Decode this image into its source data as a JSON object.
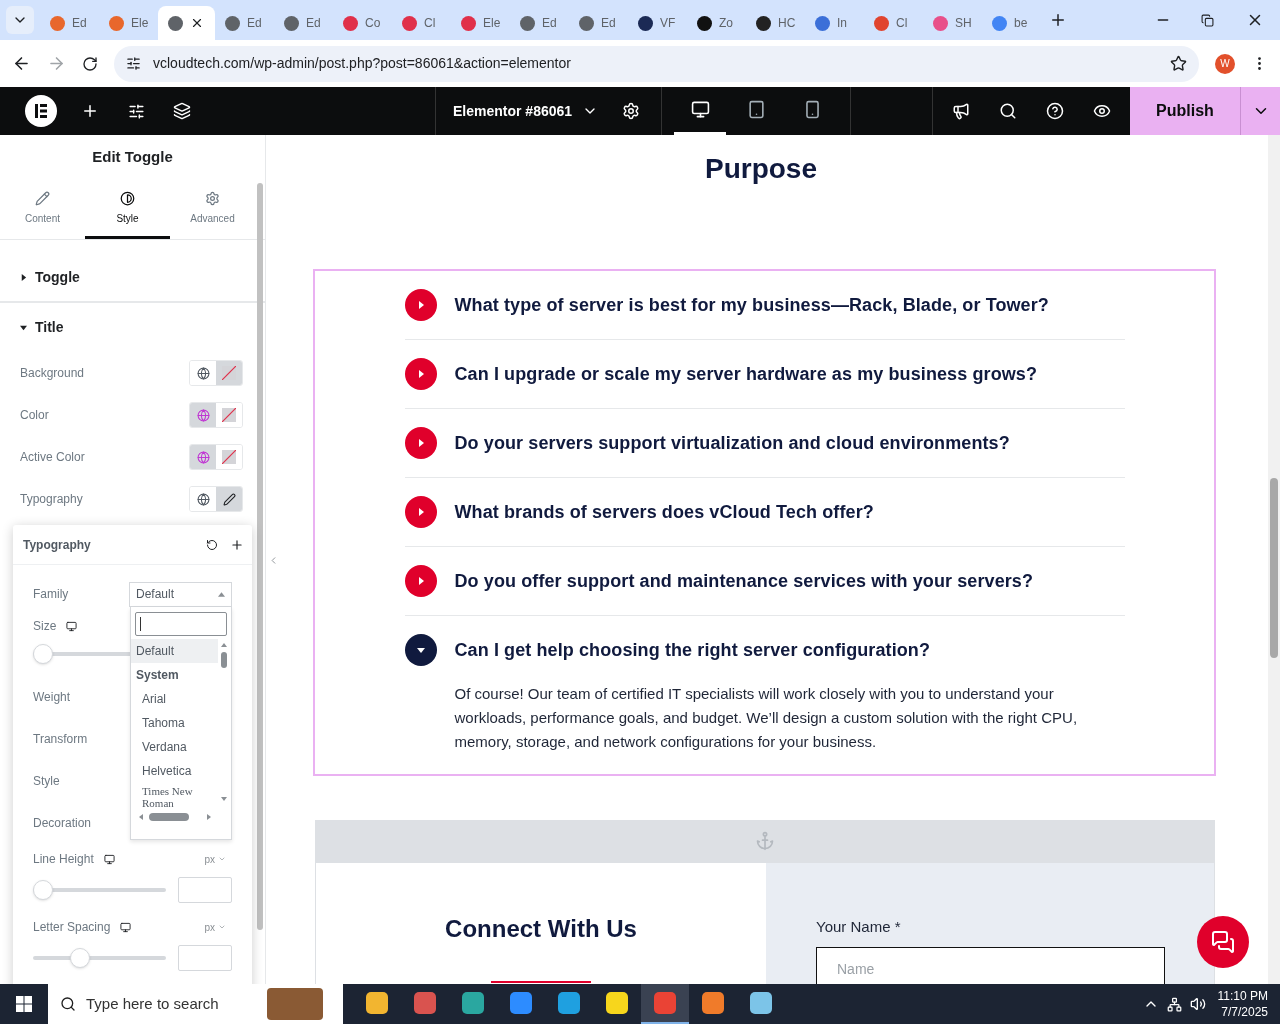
{
  "browser": {
    "tabs": [
      {
        "label": "Ed",
        "color": "#e8672c",
        "selected": false
      },
      {
        "label": "Ele",
        "color": "#e8672c",
        "selected": false
      },
      {
        "color": "#5f6368",
        "selected": true
      },
      {
        "label": "Ed",
        "color": "#5f6368",
        "selected": false
      },
      {
        "label": "Ed",
        "color": "#5f6368",
        "selected": false
      },
      {
        "label": "Co",
        "color": "#e0304a",
        "selected": false
      },
      {
        "label": "Cl",
        "color": "#e0304a",
        "selected": false
      },
      {
        "label": "Ele",
        "color": "#e0304a",
        "selected": false
      },
      {
        "label": "Ed",
        "color": "#5f6368",
        "selected": false
      },
      {
        "label": "Ed",
        "color": "#5f6368",
        "selected": false
      },
      {
        "label": "VF",
        "color": "#1b2a55",
        "selected": false
      },
      {
        "label": "Zo",
        "color": "#111111",
        "selected": false
      },
      {
        "label": "HC",
        "color": "#222222",
        "selected": false
      },
      {
        "label": "In",
        "color": "#3b6fd8",
        "selected": false
      },
      {
        "label": "Cl",
        "color": "#e0442f",
        "selected": false
      },
      {
        "label": "SH",
        "color": "#e8508a",
        "selected": false
      },
      {
        "label": "be",
        "color": "#4285f4",
        "selected": false
      }
    ],
    "url": "vcloudtech.com/wp-admin/post.php?post=86061&action=elementor",
    "profile": "W"
  },
  "editor": {
    "document_title": "Elementor #86061",
    "devices": [
      {
        "kind": "desktop",
        "selected": true
      },
      {
        "kind": "tablet",
        "selected": false
      },
      {
        "kind": "mobile",
        "selected": false
      }
    ],
    "publish": "Publish"
  },
  "panel": {
    "title": "Edit Toggle",
    "tabs": [
      {
        "label": "Content",
        "kind": "pencil",
        "selected": false
      },
      {
        "label": "Style",
        "kind": "contrast",
        "selected": true
      },
      {
        "label": "Advanced",
        "kind": "gear",
        "selected": false
      }
    ],
    "sections": [
      {
        "label": "Toggle",
        "expanded": false
      },
      {
        "label": "Title",
        "expanded": true
      }
    ],
    "controls": [
      {
        "label": "Background",
        "kind": "color",
        "global_active": false,
        "picker_active": true
      },
      {
        "label": "Color",
        "kind": "color",
        "global_active": true,
        "picker_active": false
      },
      {
        "label": "Active Color",
        "kind": "color",
        "global_active": true,
        "picker_active": false
      },
      {
        "label": "Typography",
        "kind": "typography",
        "global_active": false,
        "picker_active": true
      }
    ]
  },
  "typography_popover": {
    "title": "Typography",
    "family_label": "Family",
    "family_value": "Default",
    "fields": [
      {
        "label": "Size",
        "kind": "slider",
        "responsive": true,
        "level": 0
      },
      {
        "label": "Weight",
        "kind": "select"
      },
      {
        "label": "Transform",
        "kind": "select"
      },
      {
        "label": "Style",
        "kind": "select"
      },
      {
        "label": "Decoration",
        "kind": "select"
      },
      {
        "label": "Line Height",
        "kind": "slider-input",
        "responsive": true,
        "unit": "px",
        "level": 0
      },
      {
        "label": "Letter Spacing",
        "kind": "slider-input",
        "responsive": true,
        "unit": "px",
        "level": 0.33
      }
    ],
    "options": [
      {
        "label": "Default",
        "kind": "option",
        "selected": true
      },
      {
        "label": "System",
        "kind": "group"
      },
      {
        "label": "Arial",
        "kind": "option",
        "selected": false
      },
      {
        "label": "Tahoma",
        "kind": "option",
        "selected": false
      },
      {
        "label": "Verdana",
        "kind": "option",
        "selected": false
      },
      {
        "label": "Helvetica",
        "kind": "option",
        "selected": false
      },
      {
        "label": "Times New Roman",
        "kind": "serif",
        "selected": false
      }
    ]
  },
  "page": {
    "heading": "Purpose",
    "faq": [
      {
        "question": "What type of server is best for my business—Rack, Blade, or Tower?",
        "expanded": false
      },
      {
        "question": "Can I upgrade or scale my server hardware as my business grows?",
        "expanded": false
      },
      {
        "question": "Do your servers support virtualization and cloud environments?",
        "expanded": false
      },
      {
        "question": "What brands of servers does vCloud Tech offer?",
        "expanded": false
      },
      {
        "question": "Do you offer support and maintenance services with your servers?",
        "expanded": false
      },
      {
        "question": "Can I get help choosing the right server configuration?",
        "expanded": true,
        "answer": "Of course! Our team of certified IT specialists will work closely with you to understand your workloads, performance goals, and budget. We’ll design a custom solution with the right CPU, memory, storage, and network configurations for your business."
      }
    ],
    "contact": {
      "heading": "Connect With Us",
      "name_label": "Your Name *",
      "name_placeholder": "Name"
    }
  },
  "taskbar": {
    "search_placeholder": "Type here to search",
    "apps": [
      {
        "color": "#f2b530",
        "selected": false
      },
      {
        "color": "#d9534f",
        "selected": false
      },
      {
        "color": "#2aa7a0",
        "selected": false
      },
      {
        "color": "#2d8cff",
        "selected": false
      },
      {
        "color": "#1fa0e0",
        "selected": false
      },
      {
        "color": "#f7d61c",
        "selected": false
      },
      {
        "color": "#ea4335",
        "selected": true
      },
      {
        "color": "#f07b2a",
        "selected": false
      },
      {
        "color": "#7cc4e8",
        "selected": false
      }
    ],
    "time": "11:10 PM",
    "date": "7/7/2025"
  }
}
